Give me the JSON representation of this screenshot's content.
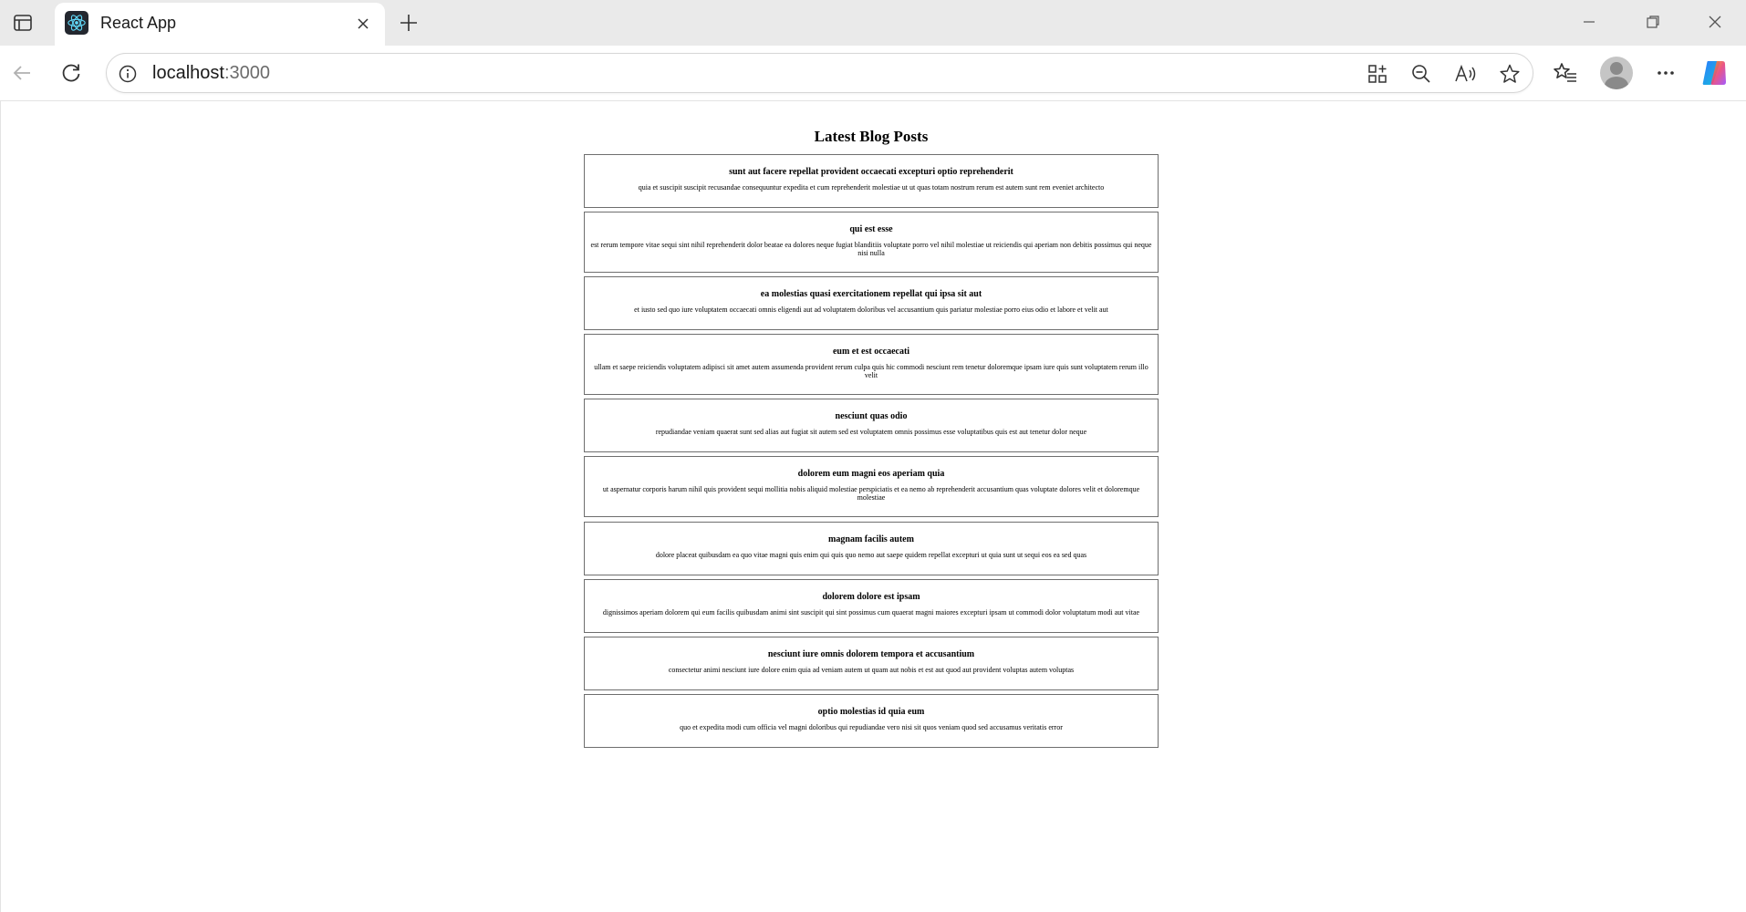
{
  "browser": {
    "tab": {
      "title": "React App",
      "favicon": "react-logo-icon"
    },
    "address": {
      "host": "localhost",
      "port": ":3000"
    },
    "icons": {
      "tab_actions": "tab-actions-icon",
      "close_tab": "close-icon",
      "new_tab": "plus-icon",
      "minimize": "minimize-icon",
      "restore": "restore-icon",
      "close_window": "close-icon",
      "back": "back-arrow-icon",
      "refresh": "refresh-icon",
      "site_info": "info-icon",
      "app_available": "app-available-icon",
      "zoom_out": "zoom-out-icon",
      "read_aloud": "read-aloud-icon",
      "favorite": "star-icon",
      "favorites": "favorites-icon",
      "profile": "profile-icon",
      "more": "more-icon",
      "copilot": "copilot-icon"
    }
  },
  "page": {
    "title": "Latest Blog Posts",
    "posts": [
      {
        "title": "sunt aut facere repellat provident occaecati excepturi optio reprehenderit",
        "body": "quia et suscipit suscipit recusandae consequuntur expedita et cum reprehenderit molestiae ut ut quas totam nostrum rerum est autem sunt rem eveniet architecto"
      },
      {
        "title": "qui est esse",
        "body": "est rerum tempore vitae sequi sint nihil reprehenderit dolor beatae ea dolores neque fugiat blanditiis voluptate porro vel nihil molestiae ut reiciendis qui aperiam non debitis possimus qui neque nisi nulla"
      },
      {
        "title": "ea molestias quasi exercitationem repellat qui ipsa sit aut",
        "body": "et iusto sed quo iure voluptatem occaecati omnis eligendi aut ad voluptatem doloribus vel accusantium quis pariatur molestiae porro eius odio et labore et velit aut"
      },
      {
        "title": "eum et est occaecati",
        "body": "ullam et saepe reiciendis voluptatem adipisci sit amet autem assumenda provident rerum culpa quis hic commodi nesciunt rem tenetur doloremque ipsam iure quis sunt voluptatem rerum illo velit"
      },
      {
        "title": "nesciunt quas odio",
        "body": "repudiandae veniam quaerat sunt sed alias aut fugiat sit autem sed est voluptatem omnis possimus esse voluptatibus quis est aut tenetur dolor neque"
      },
      {
        "title": "dolorem eum magni eos aperiam quia",
        "body": "ut aspernatur corporis harum nihil quis provident sequi mollitia nobis aliquid molestiae perspiciatis et ea nemo ab reprehenderit accusantium quas voluptate dolores velit et doloremque molestiae"
      },
      {
        "title": "magnam facilis autem",
        "body": "dolore placeat quibusdam ea quo vitae magni quis enim qui quis quo nemo aut saepe quidem repellat excepturi ut quia sunt ut sequi eos ea sed quas"
      },
      {
        "title": "dolorem dolore est ipsam",
        "body": "dignissimos aperiam dolorem qui eum facilis quibusdam animi sint suscipit qui sint possimus cum quaerat magni maiores excepturi ipsam ut commodi dolor voluptatum modi aut vitae"
      },
      {
        "title": "nesciunt iure omnis dolorem tempora et accusantium",
        "body": "consectetur animi nesciunt iure dolore enim quia ad veniam autem ut quam aut nobis et est aut quod aut provident voluptas autem voluptas"
      },
      {
        "title": "optio molestias id quia eum",
        "body": "quo et expedita modi cum officia vel magni doloribus qui repudiandae vero nisi sit quos veniam quod sed accusamus veritatis error"
      }
    ]
  }
}
